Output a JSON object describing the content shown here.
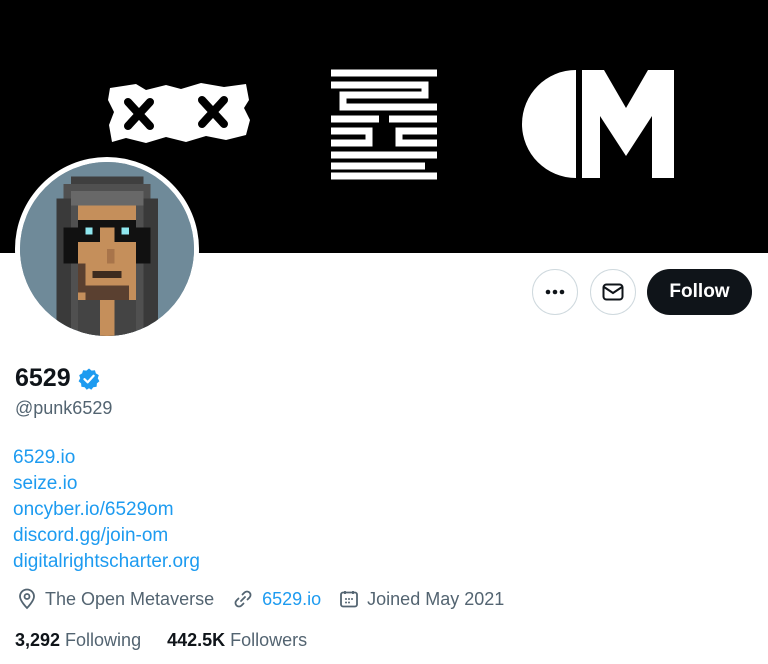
{
  "banner": {
    "logos": [
      "xx-eyes-logo",
      "seize-logo",
      "om-logo"
    ]
  },
  "profile": {
    "display_name": "6529",
    "handle": "@punk6529",
    "verified": true,
    "bio_links": [
      "6529.io",
      "seize.io",
      "oncyber.io/6529om",
      "discord.gg/join-om",
      "digitalrightscharter.org"
    ],
    "location": "The Open Metaverse",
    "website": "6529.io",
    "joined": "Joined May 2021",
    "following_count": "3,292",
    "following_label": "Following",
    "followers_count": "442.5K",
    "followers_label": "Followers"
  },
  "actions": {
    "follow_label": "Follow",
    "more_icon": "ellipsis-icon",
    "message_icon": "envelope-icon"
  },
  "colors": {
    "link": "#1d9bf0",
    "verified": "#1d9bf0",
    "follow_bg": "#0f1419",
    "banner_bg": "#000000"
  }
}
